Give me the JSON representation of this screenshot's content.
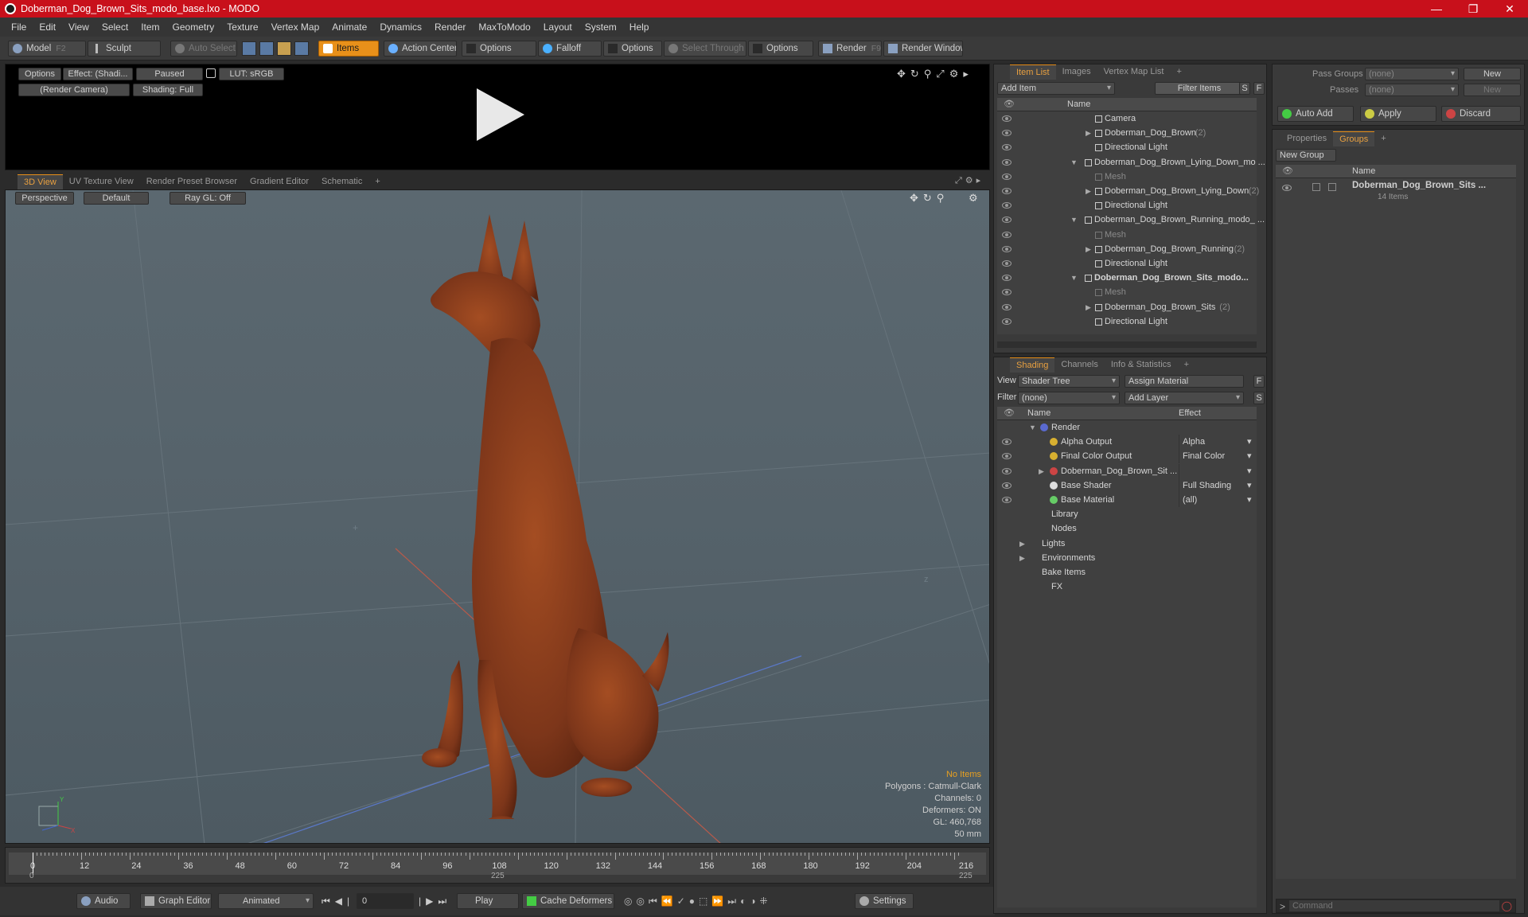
{
  "window": {
    "title": "Doberman_Dog_Brown_Sits_modo_base.lxo - MODO",
    "controls": [
      "—",
      "❐",
      "✕"
    ]
  },
  "menu": [
    "File",
    "Edit",
    "View",
    "Select",
    "Item",
    "Geometry",
    "Texture",
    "Vertex Map",
    "Animate",
    "Dynamics",
    "Render",
    "MaxToModo",
    "Layout",
    "System",
    "Help"
  ],
  "toolbar": {
    "model": "Model",
    "model_key": "F2",
    "sculpt": "Sculpt",
    "auto_select": "Auto Select",
    "items": "Items",
    "action_center": "Action Center",
    "options1": "Options",
    "falloff": "Falloff",
    "options2": "Options",
    "select_through": "Select Through",
    "options3": "Options",
    "render": "Render",
    "render_key": "F9",
    "render_window": "Render Window"
  },
  "preview": {
    "options": "Options",
    "effect": "Effect: (Shadi...",
    "paused": "Paused",
    "lut": "LUT: sRGB",
    "camera": "(Render Camera)",
    "shading": "Shading: Full"
  },
  "viewport_tabs": [
    "3D View",
    "UV Texture View",
    "Render Preset Browser",
    "Gradient Editor",
    "Schematic",
    "+"
  ],
  "viewport": {
    "perspective": "Perspective",
    "default": "Default",
    "raygl": "Ray GL: Off",
    "stats": {
      "no_items": "No Items",
      "polygons": "Polygons : Catmull-Clark",
      "channels": "Channels: 0",
      "deformers": "Deformers: ON",
      "gl": "GL: 460,768",
      "lens": "50 mm"
    },
    "axis_labels": {
      "x": "X",
      "y": "Y",
      "z": "Z"
    },
    "colors": {
      "bg": "#556068",
      "dog": "#8a3f1c"
    }
  },
  "timeline": {
    "ticks": [
      "0",
      "12",
      "24",
      "36",
      "48",
      "60",
      "72",
      "84",
      "96",
      "108",
      "120",
      "132",
      "144",
      "156",
      "168",
      "180",
      "192",
      "204",
      "216"
    ],
    "start": "0",
    "mid": "225",
    "end": "225"
  },
  "bottom": {
    "audio": "Audio",
    "graph_editor": "Graph Editor",
    "animated": "Animated",
    "frame": "0",
    "play": "Play",
    "cache": "Cache Deformers",
    "settings": "Settings"
  },
  "item_list": {
    "tabs": [
      "Item List",
      "Images",
      "Vertex Map List",
      "+"
    ],
    "add_item": "Add Item",
    "filter_items": "Filter Items",
    "s": "S",
    "f": "F",
    "col_name": "Name",
    "rows": [
      {
        "label": "Camera",
        "indent": 3,
        "gray": false,
        "bold": false,
        "arrow": "",
        "num": ""
      },
      {
        "label": "Doberman_Dog_Brown",
        "indent": 3,
        "gray": false,
        "bold": false,
        "arrow": "▶",
        "num": "(2)"
      },
      {
        "label": "Directional Light",
        "indent": 3,
        "gray": false,
        "bold": false,
        "arrow": "",
        "num": ""
      },
      {
        "label": "Doberman_Dog_Brown_Lying_Down_mo ...",
        "indent": 2,
        "gray": false,
        "bold": false,
        "arrow": "▼",
        "num": ""
      },
      {
        "label": "Mesh",
        "indent": 3,
        "gray": true,
        "bold": false,
        "arrow": "",
        "num": ""
      },
      {
        "label": "Doberman_Dog_Brown_Lying_Down",
        "indent": 3,
        "gray": false,
        "bold": false,
        "arrow": "▶",
        "num": "(2)"
      },
      {
        "label": "Directional Light",
        "indent": 3,
        "gray": false,
        "bold": false,
        "arrow": "",
        "num": ""
      },
      {
        "label": "Doberman_Dog_Brown_Running_modo_ ...",
        "indent": 2,
        "gray": false,
        "bold": false,
        "arrow": "▼",
        "num": ""
      },
      {
        "label": "Mesh",
        "indent": 3,
        "gray": true,
        "bold": false,
        "arrow": "",
        "num": ""
      },
      {
        "label": "Doberman_Dog_Brown_Running",
        "indent": 3,
        "gray": false,
        "bold": false,
        "arrow": "▶",
        "num": "(2)"
      },
      {
        "label": "Directional Light",
        "indent": 3,
        "gray": false,
        "bold": false,
        "arrow": "",
        "num": ""
      },
      {
        "label": "Doberman_Dog_Brown_Sits_modo...",
        "indent": 2,
        "gray": false,
        "bold": true,
        "arrow": "▼",
        "num": ""
      },
      {
        "label": "Mesh",
        "indent": 3,
        "gray": true,
        "bold": false,
        "arrow": "",
        "num": ""
      },
      {
        "label": "Doberman_Dog_Brown_Sits",
        "indent": 3,
        "gray": false,
        "bold": false,
        "arrow": "▶",
        "num": "(2)"
      },
      {
        "label": "Directional Light",
        "indent": 3,
        "gray": false,
        "bold": false,
        "arrow": "",
        "num": ""
      }
    ]
  },
  "shading": {
    "tabs": [
      "Shading",
      "Channels",
      "Info & Statistics",
      "+"
    ],
    "view_label": "View",
    "view_value": "Shader Tree",
    "assign_material": "Assign Material",
    "filter_label": "Filter",
    "filter_value": "(none)",
    "add_layer": "Add Layer",
    "f": "F",
    "s": "S",
    "col_name": "Name",
    "col_effect": "Effect",
    "rows": [
      {
        "label": "Render",
        "indent": 1,
        "arrow": "▼",
        "effect": "",
        "eye": false
      },
      {
        "label": "Alpha Output",
        "indent": 2,
        "arrow": "",
        "effect": "Alpha",
        "eye": true
      },
      {
        "label": "Final Color Output",
        "indent": 2,
        "arrow": "",
        "effect": "Final Color",
        "eye": true
      },
      {
        "label": "Doberman_Dog_Brown_Sit ...",
        "indent": 2,
        "arrow": "▶",
        "effect": "",
        "eye": true
      },
      {
        "label": "Base Shader",
        "indent": 2,
        "arrow": "",
        "effect": "Full Shading",
        "eye": true
      },
      {
        "label": "Base Material",
        "indent": 2,
        "arrow": "",
        "effect": "(all)",
        "eye": true
      },
      {
        "label": "Library",
        "indent": 1,
        "arrow": "",
        "effect": "",
        "eye": false
      },
      {
        "label": "Nodes",
        "indent": 1,
        "arrow": "",
        "effect": "",
        "eye": false
      },
      {
        "label": "Lights",
        "indent": 0,
        "arrow": "▶",
        "effect": "",
        "eye": false
      },
      {
        "label": "Environments",
        "indent": 0,
        "arrow": "▶",
        "effect": "",
        "eye": false
      },
      {
        "label": "Bake Items",
        "indent": 0,
        "arrow": "",
        "effect": "",
        "eye": false
      },
      {
        "label": "FX",
        "indent": 1,
        "arrow": "",
        "effect": "",
        "eye": false
      }
    ]
  },
  "pass": {
    "pass_groups": "Pass Groups",
    "pass_groups_value": "(none)",
    "new1": "New",
    "passes": "Passes",
    "passes_value": "(none)",
    "new2": "New",
    "auto_add": "Auto Add",
    "apply": "Apply",
    "discard": "Discard"
  },
  "groups": {
    "tabs": [
      "Properties",
      "Groups",
      "+"
    ],
    "new_group": "New Group",
    "col_name": "Name",
    "group_name": "Doberman_Dog_Brown_Sits ...",
    "group_count": "14 Items"
  },
  "command": {
    "placeholder": "Command",
    "prompt": ">"
  }
}
